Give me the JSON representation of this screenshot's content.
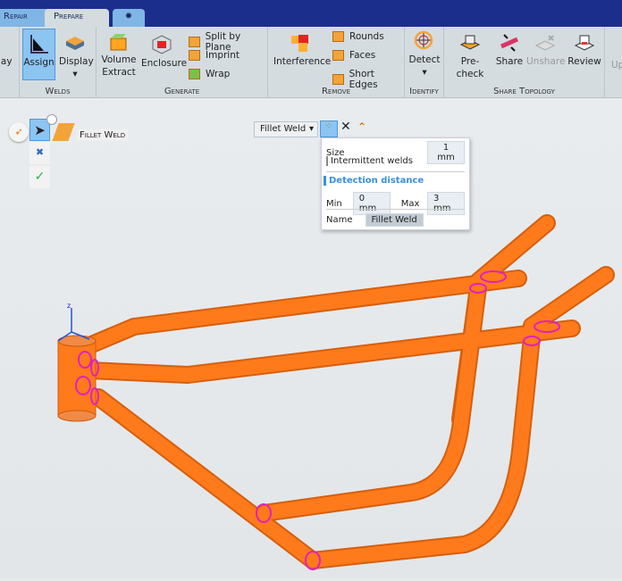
{
  "tabs": [
    {
      "label": "Repair"
    },
    {
      "label": "Prepare",
      "active": true
    },
    {
      "label": "",
      "icon": "gear-bug-icon"
    }
  ],
  "ribbon": {
    "partial_left": "lay",
    "welds": {
      "label": "Welds",
      "assign": "Assign",
      "display": "Display"
    },
    "generate": {
      "label": "Generate",
      "volume_extract": "Volume Extract",
      "enclosure": "Enclosure",
      "split": "Split by Plane",
      "imprint": "Imprint",
      "wrap": "Wrap"
    },
    "remove": {
      "label": "Remove",
      "interference": "Interference",
      "rounds": "Rounds",
      "faces": "Faces",
      "short_edges": "Short Edges"
    },
    "identify": {
      "label": "Identify",
      "detect": "Detect"
    },
    "share": {
      "label": "Share Topology",
      "precheck": "Pre-check",
      "share": "Share",
      "unshare": "Unshare",
      "review": "Review"
    },
    "partial_right": "Up"
  },
  "tool": {
    "title": "Fillet Weld"
  },
  "options": {
    "dropdown": "Fillet Weld",
    "size_label": "Size",
    "size": "1 mm",
    "intermittent": "Intermittent welds",
    "detection": "Detection distance",
    "min_label": "Min",
    "min": "0 mm",
    "max_label": "Max",
    "max": "3 mm",
    "name_label": "Name",
    "name": "Fillet Weld"
  },
  "colors": {
    "titlebar": "#1c2e8c",
    "frame": "#ff7a1a",
    "weld": "#e020c0",
    "accent": "#3a8fe0"
  }
}
